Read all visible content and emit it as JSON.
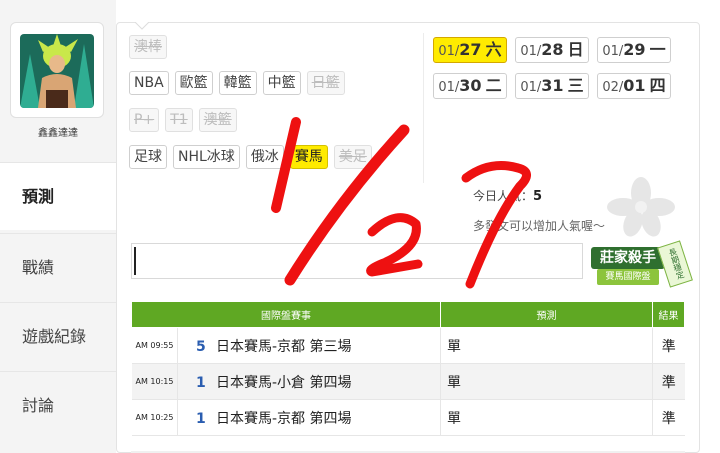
{
  "user": {
    "name": "鑫鑫達達"
  },
  "nav": [
    {
      "label": "預測",
      "active": true
    },
    {
      "label": "戰績",
      "active": false
    },
    {
      "label": "遊戲紀錄",
      "active": false
    },
    {
      "label": "討論",
      "active": false
    }
  ],
  "categories": {
    "row1": [
      {
        "label": "澳棒",
        "state": "disabled"
      }
    ],
    "row2": [
      {
        "label": "NBA",
        "state": "normal"
      },
      {
        "label": "歐籃",
        "state": "normal"
      },
      {
        "label": "韓籃",
        "state": "normal"
      },
      {
        "label": "中籃",
        "state": "normal"
      },
      {
        "label": "日籃",
        "state": "disabled"
      }
    ],
    "row3": [
      {
        "label": "P+",
        "state": "disabled"
      },
      {
        "label": "T1",
        "state": "disabled"
      },
      {
        "label": "澳籃",
        "state": "disabled"
      }
    ],
    "row4": [
      {
        "label": "足球",
        "state": "normal"
      },
      {
        "label": "NHL冰球",
        "state": "normal"
      },
      {
        "label": "俄冰",
        "state": "normal"
      },
      {
        "label": "賽馬",
        "state": "selected"
      },
      {
        "label": "美足",
        "state": "disabled"
      }
    ]
  },
  "dates": [
    {
      "month": "01/",
      "day": "27",
      "weekday": "六",
      "selected": true
    },
    {
      "month": "01/",
      "day": "28",
      "weekday": "日",
      "selected": false
    },
    {
      "month": "01/",
      "day": "29",
      "weekday": "一",
      "selected": false
    },
    {
      "month": "01/",
      "day": "30",
      "weekday": "二",
      "selected": false
    },
    {
      "month": "01/",
      "day": "31",
      "weekday": "三",
      "selected": false
    },
    {
      "month": "02/",
      "day": "01",
      "weekday": "四",
      "selected": false
    }
  ],
  "popularity": {
    "label": "今日人氣：",
    "value": "5"
  },
  "hint": "多發文可以增加人氣喔～",
  "badge": {
    "title": "莊家殺手",
    "subtitle": "賽馬國際盤",
    "tag": "長期穩定"
  },
  "table": {
    "headers": {
      "event": "國際盤賽事",
      "prediction": "預測",
      "result": "結果"
    },
    "rows": [
      {
        "time": "AM 09:55",
        "num": "5",
        "event": "日本賽馬-京都 第三場",
        "prediction": "單",
        "result": "準"
      },
      {
        "time": "AM 10:15",
        "num": "1",
        "event": "日本賽馬-小倉 第四場",
        "prediction": "單",
        "result": "準"
      },
      {
        "time": "AM 10:25",
        "num": "1",
        "event": "日本賽馬-京都 第四場",
        "prediction": "單",
        "result": "準"
      }
    ]
  },
  "annotation": {
    "text": "1/27",
    "color": "#ee1111"
  },
  "colors": {
    "accent_yellow": "#ffeb00",
    "header_green": "#5fa823",
    "result_green": "#3a9b3a"
  }
}
